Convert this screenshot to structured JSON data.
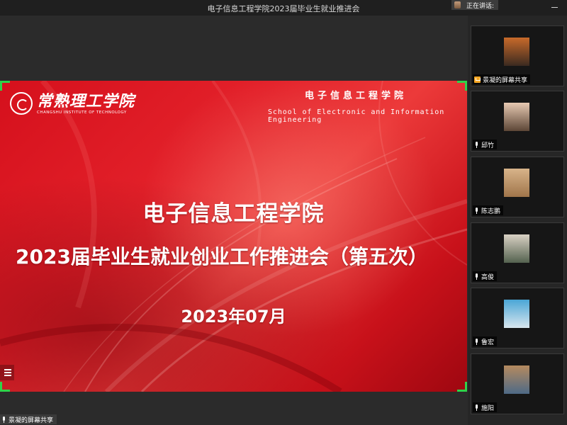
{
  "window": {
    "title": "电子信息工程学院2023届毕业生就业推进会"
  },
  "speaking": {
    "label": "正在讲话:"
  },
  "slide": {
    "logo_cn": "常熟理工学院",
    "logo_en": "CHANGSHU INSTITUTE OF TECHNOLOGY",
    "school_cn": "电子信息工程学院",
    "school_en": "School of Electronic and Information Engineering",
    "title_line1": "电子信息工程学院",
    "title_line2": "2023届毕业生就业创业工作推进会（第五次）",
    "date": "2023年07月"
  },
  "share_tag": {
    "label": "景凝的屏幕共享"
  },
  "participants": [
    {
      "name": "景凝的屏幕共享",
      "icon": "screen-share-icon",
      "colors": [
        "#c86a2a",
        "#3b2a20"
      ]
    },
    {
      "name": "邱竹",
      "icon": "mic-icon",
      "colors": [
        "#e7c9b2",
        "#5c4636"
      ]
    },
    {
      "name": "陈志鹏",
      "icon": "mic-icon",
      "colors": [
        "#d8b48a",
        "#a0754a"
      ]
    },
    {
      "name": "高俊",
      "icon": "mic-icon",
      "colors": [
        "#d9d1c4",
        "#54624f"
      ]
    },
    {
      "name": "鲁宏",
      "icon": "mic-icon",
      "colors": [
        "#4aa6d6",
        "#d8e6ee"
      ]
    },
    {
      "name": "施阳",
      "icon": "mic-icon",
      "colors": [
        "#b58a5e",
        "#4e6a86"
      ]
    }
  ]
}
